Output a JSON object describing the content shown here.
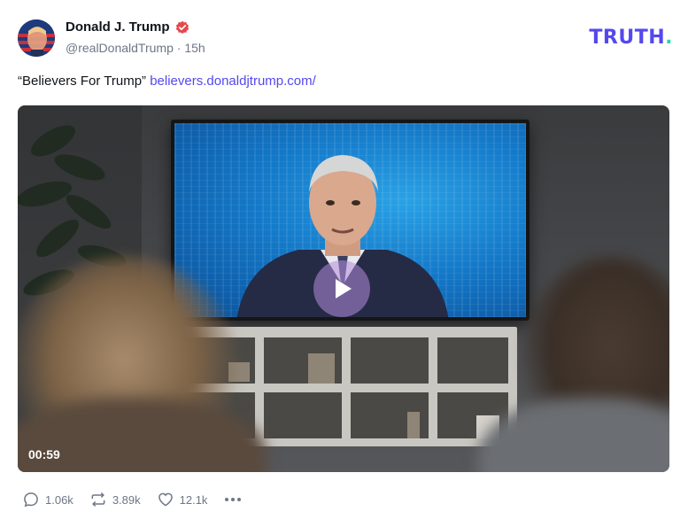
{
  "author": {
    "display_name": "Donald J. Trump",
    "handle": "@realDonaldTrump",
    "separator": " · ",
    "time_ago": "15h"
  },
  "brand": {
    "logo_text": "TRUTH",
    "logo_dot": "."
  },
  "post": {
    "text": "“Believers For Trump” ",
    "link": "believers.donaldjtrump.com/"
  },
  "video": {
    "duration": "00:59"
  },
  "actions": {
    "replies": "1.06k",
    "retruths": "3.89k",
    "likes": "12.1k"
  },
  "colors": {
    "accent": "#5448ee",
    "logo_dot": "#2fd4a7",
    "verified": "#e5484d",
    "muted": "#6e7687"
  }
}
